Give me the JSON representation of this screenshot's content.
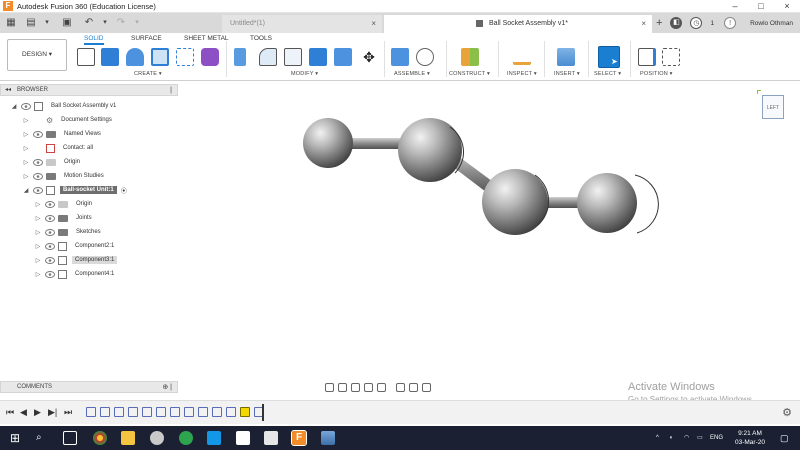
{
  "window": {
    "app_icon": "F",
    "title": "Autodesk Fusion 360 (Education License)"
  },
  "tabs": {
    "inactive_title": "Untitled*(1)",
    "active_title": "Ball Socket Assembly v1*",
    "user": "Rowlo Othman",
    "job_count": "1"
  },
  "ribbon": {
    "workspace": "DESIGN",
    "tabs": [
      "SOLID",
      "SURFACE",
      "SHEET METAL",
      "TOOLS"
    ],
    "groups": [
      "CREATE",
      "MODIFY",
      "ASSEMBLE",
      "CONSTRUCT",
      "INSPECT",
      "INSERT",
      "SELECT",
      "POSITION"
    ]
  },
  "browser": {
    "title": "BROWSER",
    "items": [
      {
        "label": "Ball Socket Assembly v1",
        "level": 0,
        "icon": "document-icon"
      },
      {
        "label": "Document Settings",
        "level": 1,
        "icon": "gear-icon"
      },
      {
        "label": "Named Views",
        "level": 1,
        "icon": "folder-icon"
      },
      {
        "label": "Contact: all",
        "level": 1,
        "icon": "contact-icon"
      },
      {
        "label": "Origin",
        "level": 1,
        "icon": "folder-icon"
      },
      {
        "label": "Motion Studies",
        "level": 1,
        "icon": "folder-icon"
      },
      {
        "label": "Ball-socket Unit:1",
        "level": 1,
        "icon": "component-icon"
      },
      {
        "label": "Origin",
        "level": 2,
        "icon": "folder-icon"
      },
      {
        "label": "Joints",
        "level": 2,
        "icon": "folder-icon"
      },
      {
        "label": "Sketches",
        "level": 2,
        "icon": "folder-icon"
      },
      {
        "label": "Component2:1",
        "level": 2,
        "icon": "component-icon"
      },
      {
        "label": "Component3:1",
        "level": 2,
        "icon": "component-icon"
      },
      {
        "label": "Component4:1",
        "level": 2,
        "icon": "component-icon"
      }
    ]
  },
  "comments": {
    "title": "COMMENTS"
  },
  "viewcube": {
    "face": "LEFT"
  },
  "watermark": {
    "line1": "Activate Windows",
    "line2": "Go to Settings to activate Windows."
  },
  "taskbar": {
    "language": "ENG",
    "time": "9:21 AM",
    "date": "03-Mar-20"
  },
  "colors": {
    "accent": "#1a7fd1",
    "taskbar": "#1b2133",
    "highlight": "#f0d800"
  }
}
